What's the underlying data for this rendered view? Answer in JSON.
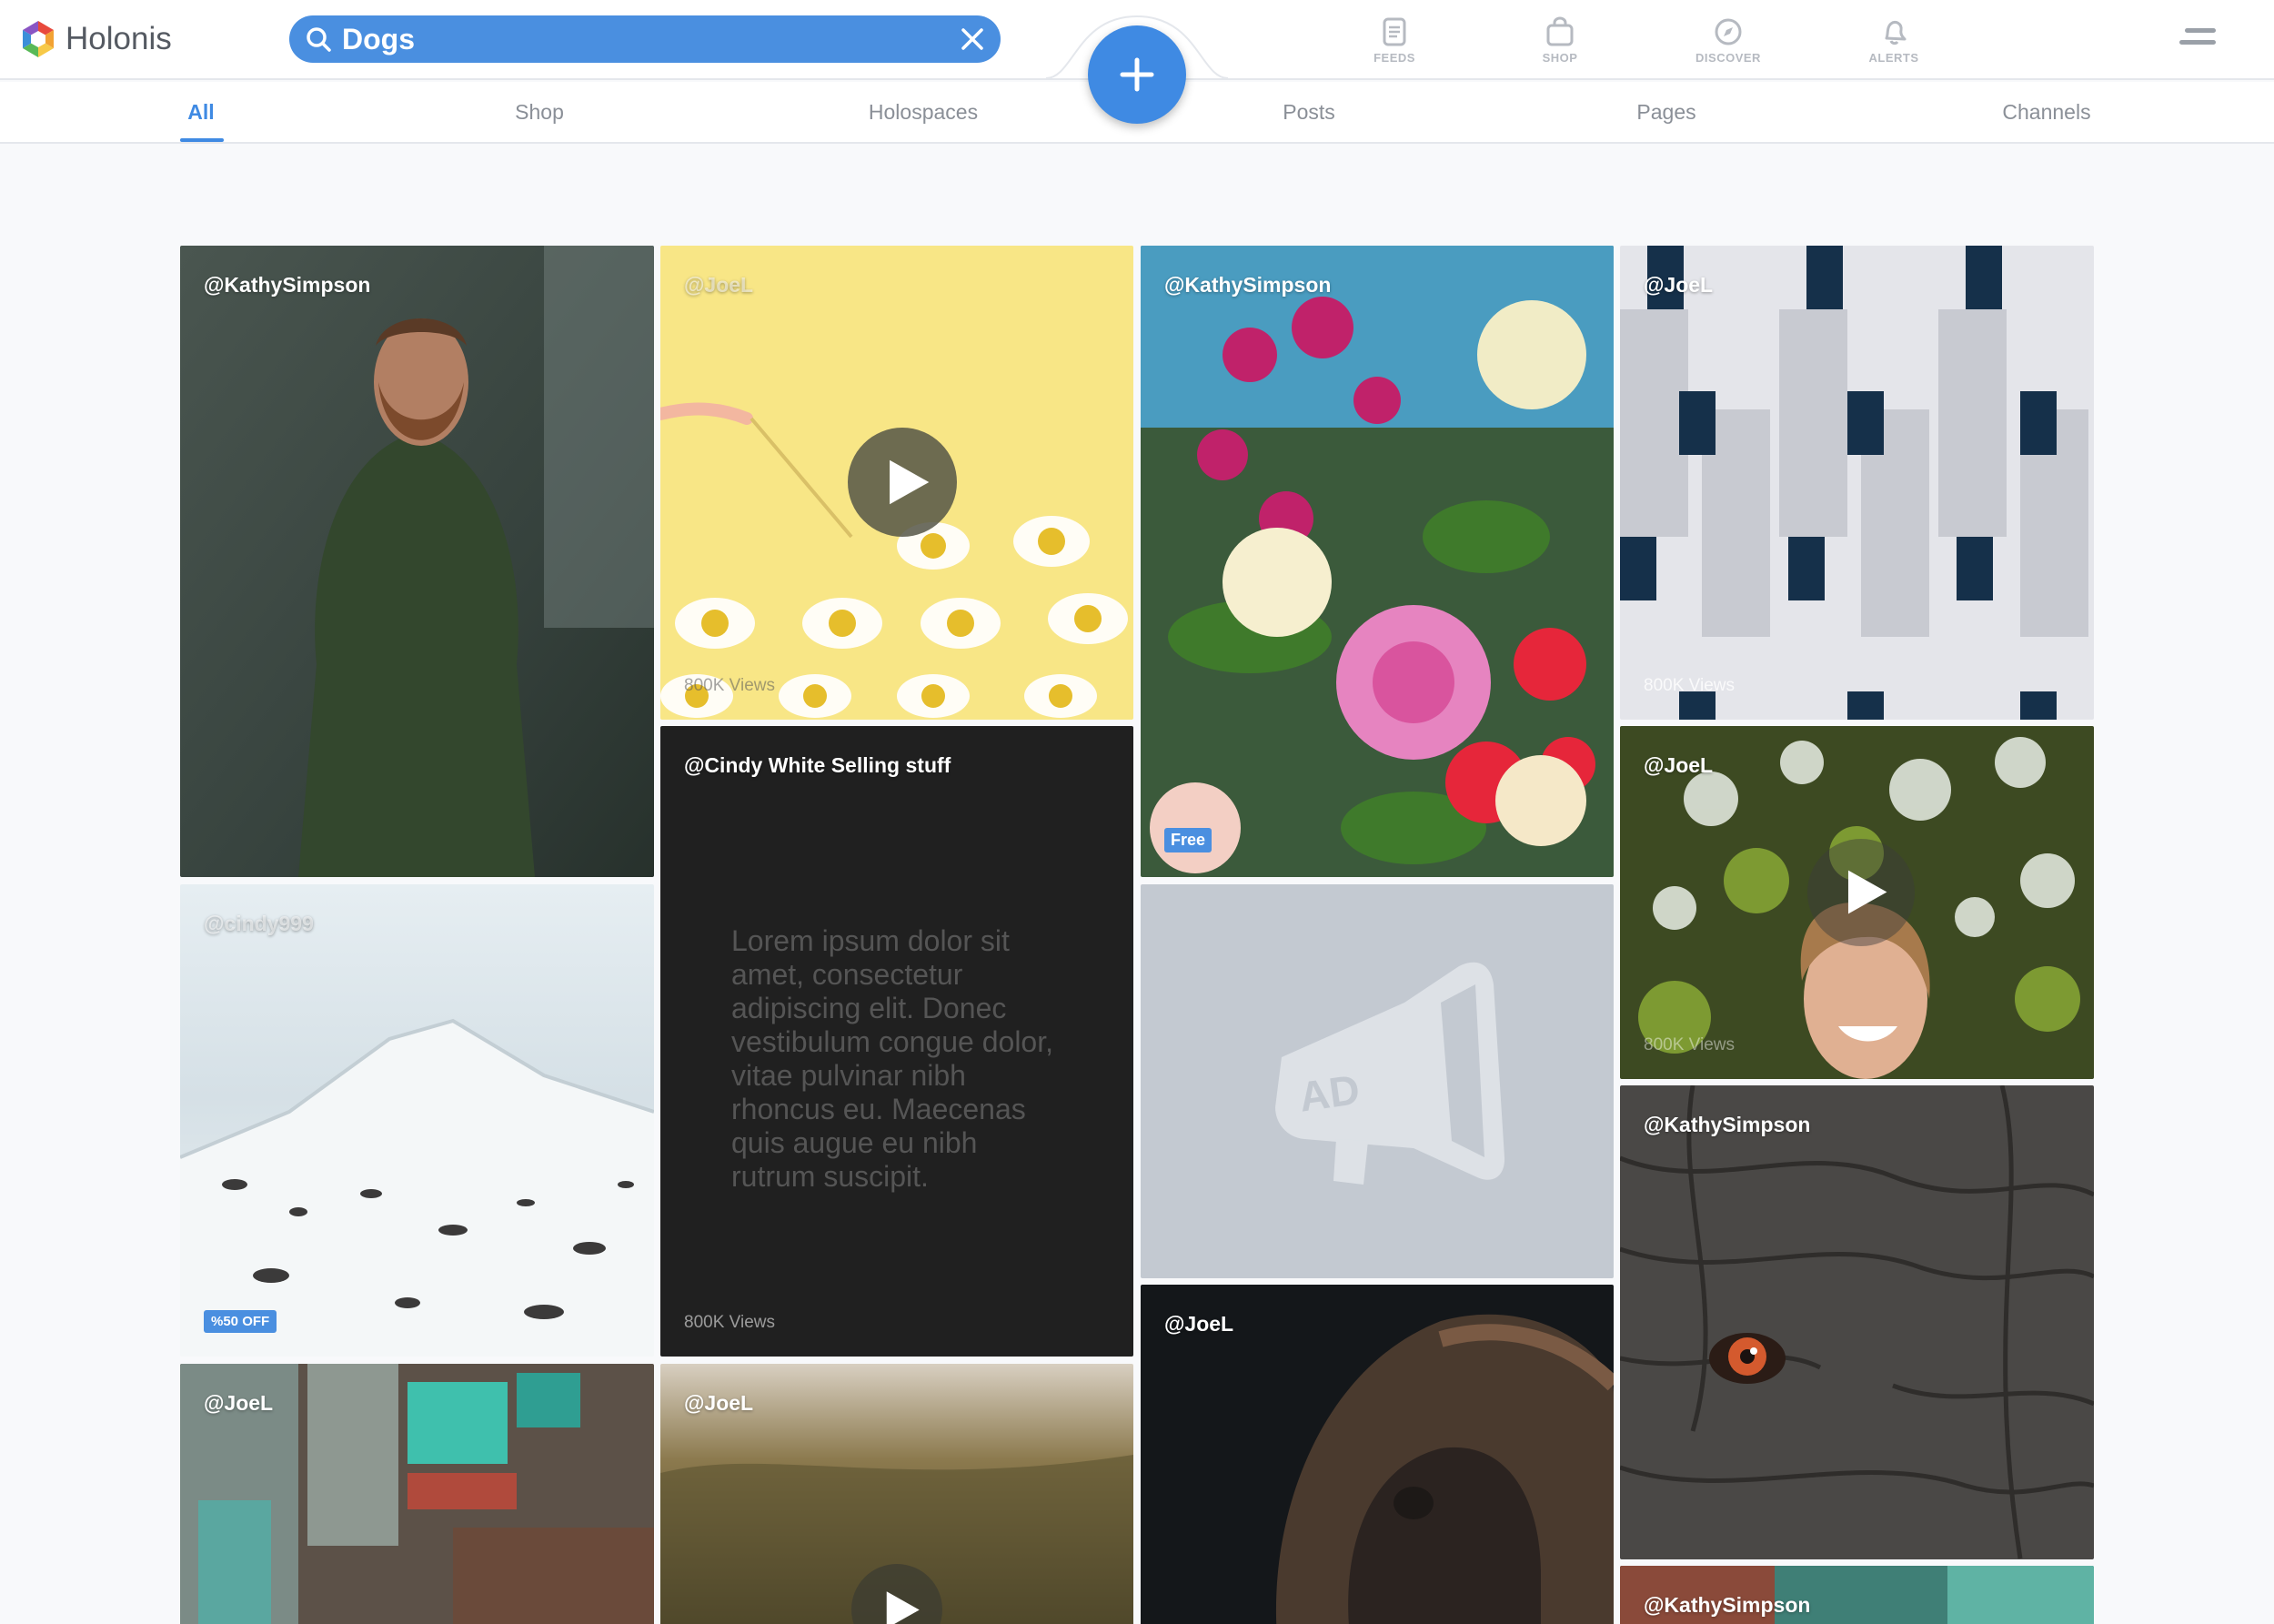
{
  "app": {
    "name": "Holonis"
  },
  "search": {
    "value": "Dogs"
  },
  "nav": {
    "feeds": "FEEDS",
    "shop": "SHOP",
    "discover": "DISCOVER",
    "alerts": "ALERTS"
  },
  "tabs": [
    "All",
    "Shop",
    "Holospaces",
    "Posts",
    "Pages",
    "Channels"
  ],
  "active_tab": "All",
  "colors": {
    "accent": "#3f8ae3",
    "search_bg": "#4a8fe0",
    "header_bg": "#ffffff",
    "page_bg": "#f8f9fb",
    "tab_inactive": "#8a8f97",
    "text_card": "#ffffff"
  },
  "cards": [
    {
      "user": "@KathySimpson",
      "type": "photo",
      "subject": "bearded man in green t-shirt"
    },
    {
      "user": "@JoeL",
      "type": "video",
      "subject": "fried eggs on yellow background",
      "views": "800K Views"
    },
    {
      "user": "@KathySimpson",
      "type": "photo",
      "subject": "flower bouquet",
      "badge": "Free"
    },
    {
      "user": "@JoeL",
      "type": "photo",
      "subject": "white building facade with windows",
      "views": "800K Views"
    },
    {
      "user": "@cindy999",
      "type": "photo",
      "subject": "snowy mountain landscape",
      "badge": "%50 OFF"
    },
    {
      "user": "@Cindy White Selling stuff",
      "type": "text",
      "text": "Lorem ipsum dolor sit amet, consectetur adipiscing elit. Donec vestibulum congue dolor, vitae pulvinar nibh rhoncus eu. Maecenas quis augue eu nibh rutrum suscipit.",
      "views": "800K Views"
    },
    {
      "type": "ad",
      "label": "AD"
    },
    {
      "user": "@JoeL",
      "type": "video",
      "subject": "laughing woman among leaves",
      "views": "800K Views"
    },
    {
      "user": "@KathySimpson",
      "type": "photo",
      "subject": "elephant eye close-up"
    },
    {
      "user": "@JoeL",
      "type": "photo",
      "subject": "gorilla portrait"
    },
    {
      "user": "@JoeL",
      "type": "photo",
      "subject": "busy city street"
    },
    {
      "user": "@JoeL",
      "type": "video",
      "subject": "forest at sunrise"
    },
    {
      "user": "@KathySimpson",
      "type": "photo",
      "subject": "city scene"
    }
  ],
  "icons": {
    "logo": "holonis-hexagon-logo",
    "search": "search-icon",
    "clear": "close-icon",
    "create": "plus-icon",
    "feeds": "feeds-icon",
    "shop": "shop-bag-icon",
    "discover": "compass-icon",
    "alerts": "bell-icon",
    "menu": "hamburger-icon",
    "play": "play-icon",
    "ad": "megaphone-icon"
  }
}
